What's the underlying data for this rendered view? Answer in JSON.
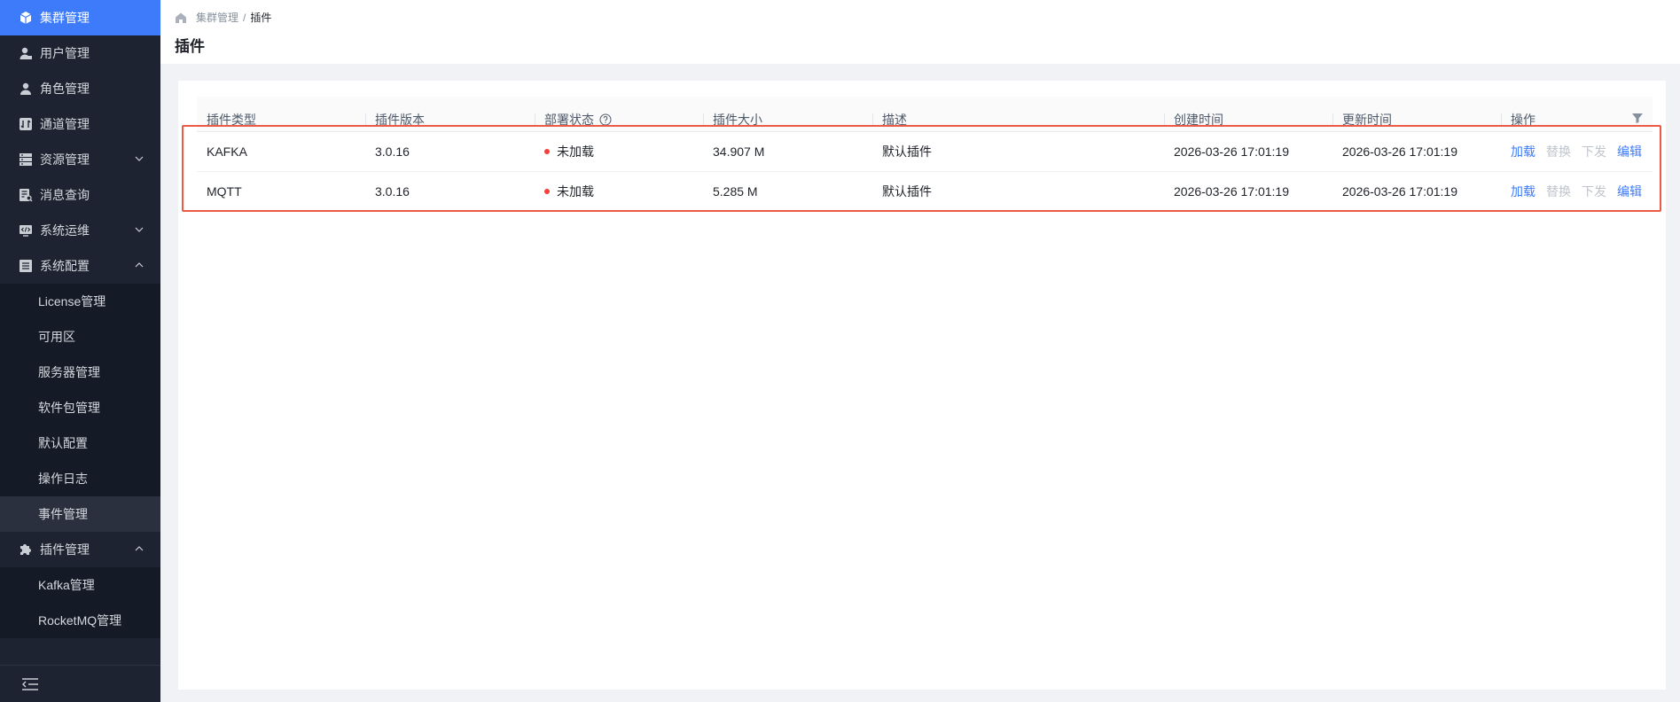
{
  "sidebar": {
    "items": [
      {
        "label": "集群管理",
        "icon": "cube-icon",
        "active": true
      },
      {
        "label": "用户管理",
        "icon": "user-icon"
      },
      {
        "label": "角色管理",
        "icon": "role-icon"
      },
      {
        "label": "通道管理",
        "icon": "channel-icon"
      },
      {
        "label": "资源管理",
        "icon": "server-icon",
        "expandable": true
      },
      {
        "label": "消息查询",
        "icon": "message-search-icon"
      },
      {
        "label": "系统运维",
        "icon": "code-monitor-icon",
        "expandable": true
      },
      {
        "label": "系统配置",
        "icon": "config-icon",
        "expanded": true
      }
    ],
    "system_config_children": [
      "License管理",
      "可用区",
      "服务器管理",
      "软件包管理",
      "默认配置",
      "操作日志",
      "事件管理"
    ],
    "plugin_menu": {
      "label": "插件管理",
      "icon": "puzzle-icon"
    },
    "plugin_children": [
      "Kafka管理",
      "RocketMQ管理"
    ]
  },
  "breadcrumb": {
    "parent": "集群管理",
    "separator": "/",
    "current": "插件"
  },
  "page_title": "插件",
  "table": {
    "columns": [
      "插件类型",
      "插件版本",
      "部署状态",
      "插件大小",
      "描述",
      "创建时间",
      "更新时间",
      "操作"
    ],
    "rows": [
      {
        "type": "KAFKA",
        "version": "3.0.16",
        "status": "未加载",
        "size": "34.907 M",
        "desc": "默认插件",
        "created": "2026-03-26 17:01:19",
        "updated": "2026-03-26 17:01:19"
      },
      {
        "type": "MQTT",
        "version": "3.0.16",
        "status": "未加载",
        "size": "5.285 M",
        "desc": "默认插件",
        "created": "2026-03-26 17:01:19",
        "updated": "2026-03-26 17:01:19"
      }
    ],
    "actions": {
      "load": "加载",
      "replace": "替换",
      "deploy": "下发",
      "edit": "编辑"
    }
  },
  "colors": {
    "accent": "#3e7bfa",
    "sidebar_bg": "#1d2330",
    "status_error": "#f53f3f",
    "highlight": "#ea5a47"
  }
}
